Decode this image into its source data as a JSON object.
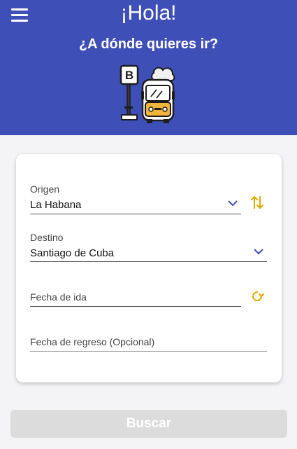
{
  "header": {
    "greeting": "¡Hola!",
    "subtitle": "¿A dónde quieres ir?",
    "bus_stop_sign": "B"
  },
  "form": {
    "origin": {
      "label": "Origen",
      "value": "La Habana"
    },
    "destination": {
      "label": "Destino",
      "value": "Santiago de Cuba"
    },
    "departure_date": {
      "label": "Fecha de ida"
    },
    "return_date": {
      "label": "Fecha de regreso (Opcional)"
    }
  },
  "actions": {
    "search_label": "Buscar"
  },
  "colors": {
    "header_bg": "#3f4fb8",
    "accent_icon": "#e0a800",
    "button_disabled": "#dcdcdc"
  },
  "icons": [
    "menu-icon",
    "bus-stop-illustration",
    "swap-icon",
    "calendar-refresh-icon",
    "chevron-down-icon"
  ]
}
